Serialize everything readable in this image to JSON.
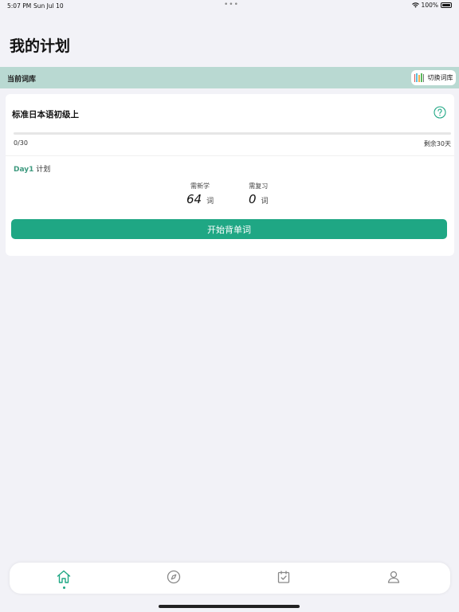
{
  "status_bar": {
    "time": "5:07 PM",
    "date": "Sun Jul 10",
    "battery": "100%"
  },
  "page": {
    "title": "我的计划"
  },
  "current_bank": {
    "label": "当前词库",
    "switch_label": "切换词库"
  },
  "plan_card": {
    "book_title": "标准日本语初级上",
    "progress_text": "0/30",
    "progress_fraction": 0,
    "remaining": "剩余30天",
    "day_label": "Day1",
    "plan_label": "计划",
    "new_label": "需新学",
    "new_count": "64",
    "new_unit": "词",
    "review_label": "需复习",
    "review_count": "0",
    "review_unit": "词",
    "start_button": "开始背单词"
  },
  "tab_bar": {
    "active": "home",
    "icons": [
      "home-icon",
      "compass-icon",
      "calendar-check-icon",
      "person-icon"
    ]
  },
  "colors": {
    "accent": "#1fa784",
    "bank_bar": "#b9d9d2",
    "day_text": "#3e9a7f",
    "background": "#f2f2f7"
  }
}
